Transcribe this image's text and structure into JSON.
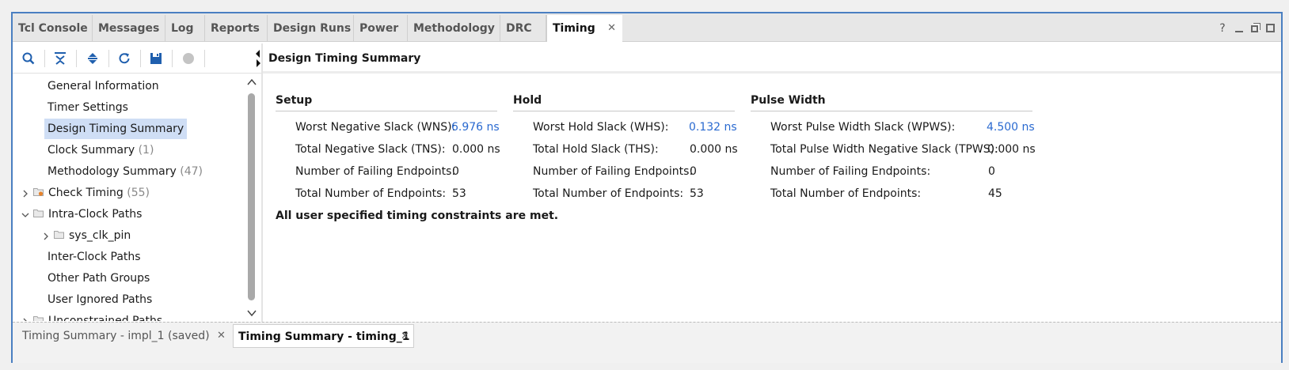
{
  "tabs": [
    {
      "label": "Tcl Console"
    },
    {
      "label": "Messages"
    },
    {
      "label": "Log"
    },
    {
      "label": "Reports"
    },
    {
      "label": "Design Runs"
    },
    {
      "label": "Power"
    },
    {
      "label": "Methodology"
    },
    {
      "label": "DRC"
    },
    {
      "label": "Timing",
      "active": true
    }
  ],
  "window_controls": {
    "help": "?"
  },
  "tree": {
    "general_information": "General Information",
    "timer_settings": "Timer Settings",
    "design_timing_summary": "Design Timing Summary",
    "clock_summary": "Clock Summary",
    "clock_summary_count": "(1)",
    "methodology_summary": "Methodology Summary",
    "methodology_summary_count": "(47)",
    "check_timing": "Check Timing",
    "check_timing_count": "(55)",
    "intra_clock_paths": "Intra-Clock Paths",
    "sys_clk_pin": "sys_clk_pin",
    "inter_clock_paths": "Inter-Clock Paths",
    "other_path_groups": "Other Path Groups",
    "user_ignored_paths": "User Ignored Paths",
    "unconstrained_paths": "Unconstrained Paths"
  },
  "panel": {
    "title": "Design Timing Summary"
  },
  "setup": {
    "heading": "Setup",
    "wns_label": "Worst Negative Slack (WNS):",
    "wns_value": "6.976 ns",
    "tns_label": "Total Negative Slack (TNS):",
    "tns_value": "0.000 ns",
    "failing_label": "Number of Failing Endpoints:",
    "failing_value": "0",
    "total_label": "Total Number of Endpoints:",
    "total_value": "53"
  },
  "hold": {
    "heading": "Hold",
    "whs_label": "Worst Hold Slack (WHS):",
    "whs_value": "0.132 ns",
    "ths_label": "Total Hold Slack (THS):",
    "ths_value": "0.000 ns",
    "failing_label": "Number of Failing Endpoints:",
    "failing_value": "0",
    "total_label": "Total Number of Endpoints:",
    "total_value": "53"
  },
  "pulse": {
    "heading": "Pulse Width",
    "wpws_label": "Worst Pulse Width Slack (WPWS):",
    "wpws_value": "4.500 ns",
    "tpws_label": "Total Pulse Width Negative Slack (TPWS):",
    "tpws_value": "0.000 ns",
    "failing_label": "Number of Failing Endpoints:",
    "failing_value": "0",
    "total_label": "Total Number of Endpoints:",
    "total_value": "45"
  },
  "status_message": "All user specified timing constraints are met.",
  "bottom_tabs": [
    {
      "label": "Timing Summary - impl_1 (saved)"
    },
    {
      "label": "Timing Summary - timing_1",
      "active": true
    }
  ],
  "colors": {
    "accent": "#2a6ad0",
    "frame": "#4a7fc1",
    "selection": "#cfdef5"
  }
}
